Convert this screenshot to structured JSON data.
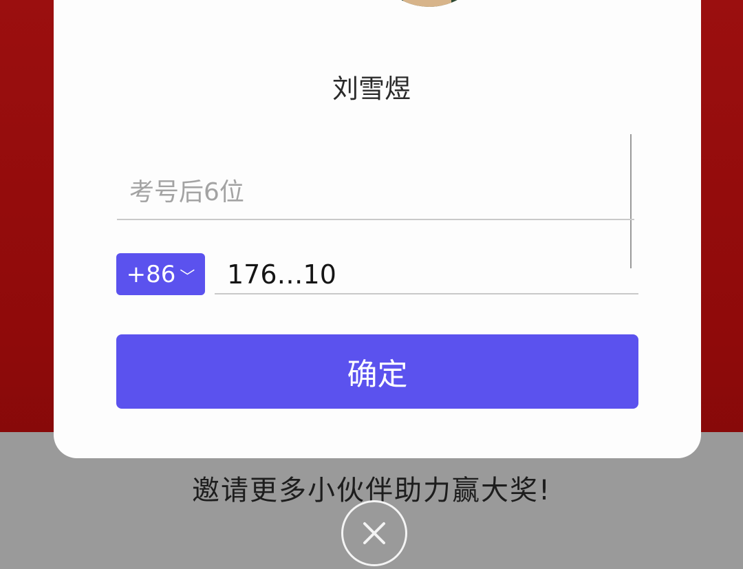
{
  "profile": {
    "name": "刘雪煜"
  },
  "form": {
    "exam_number_placeholder": "考号后6位",
    "country_code": "+86",
    "country_code_chevron": "﹀",
    "phone_value": "176…10",
    "confirm_label": "确定"
  },
  "footer": {
    "invite_text": "邀请更多小伙伴助力赢大奖!",
    "close_icon": "close-icon"
  },
  "colors": {
    "accent": "#5b52ee",
    "background_red": "#8f0a0a",
    "overlay_gray": "#9a9a9a"
  }
}
